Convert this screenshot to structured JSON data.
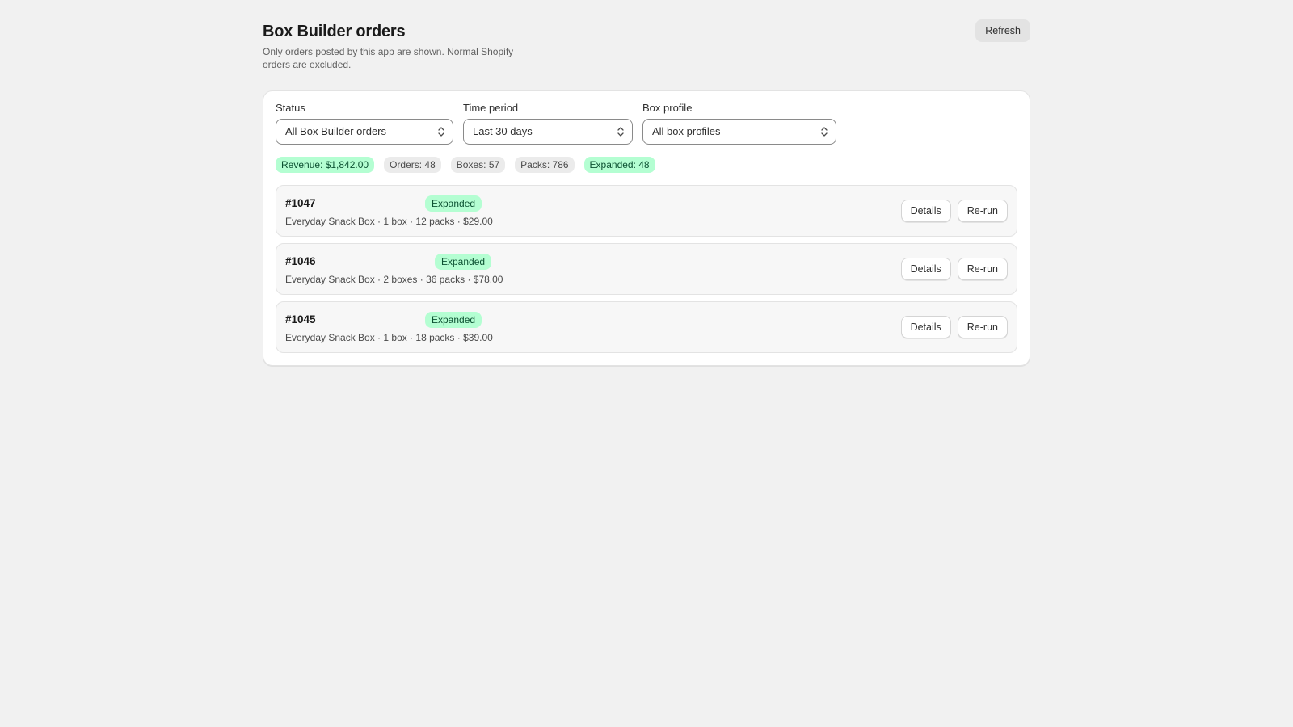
{
  "header": {
    "title": "Box Builder orders",
    "subtitle": "Only orders posted by this app are shown. Normal Shopify orders are excluded.",
    "refresh_label": "Refresh"
  },
  "filters": {
    "status": {
      "label": "Status",
      "value": "All Box Builder orders"
    },
    "time_period": {
      "label": "Time period",
      "value": "Last 30 days"
    },
    "box_profile": {
      "label": "Box profile",
      "value": "All box profiles"
    }
  },
  "stats": {
    "revenue": "Revenue: $1,842.00",
    "orders": "Orders: 48",
    "boxes": "Boxes: 57",
    "packs": "Packs: 786",
    "expanded": "Expanded: 48"
  },
  "orders": [
    {
      "id": "#1047",
      "status": "Expanded",
      "meta": "Everyday Snack Box · 1 box · 12 packs · $29.00",
      "details_label": "Details",
      "rerun_label": "Re-run"
    },
    {
      "id": "#1046",
      "status": "Expanded",
      "meta": "Everyday Snack Box · 2 boxes · 36 packs · $78.00",
      "details_label": "Details",
      "rerun_label": "Re-run"
    },
    {
      "id": "#1045",
      "status": "Expanded",
      "meta": "Everyday Snack Box · 1 box · 18 packs · $39.00",
      "details_label": "Details",
      "rerun_label": "Re-run"
    }
  ],
  "colors": {
    "page_background": "#f1f1f1",
    "success_badge": "#b4fed2",
    "success_text": "#0c5132",
    "neutral_chip": "#ebebeb"
  },
  "icons": {
    "select_chevron": "select-chevron-icon"
  }
}
